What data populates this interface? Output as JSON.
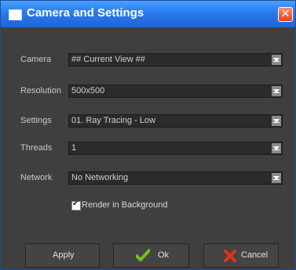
{
  "window": {
    "title": "Camera and Settings",
    "close_symbol": "✕"
  },
  "fields": {
    "camera": {
      "label": "Camera",
      "value": "## Current View ##"
    },
    "resolution": {
      "label": "Resolution",
      "value": "500x500"
    },
    "settings": {
      "label": "Settings",
      "value": "01. Ray Tracing - Low"
    },
    "threads": {
      "label": "Threads",
      "value": "1"
    },
    "network": {
      "label": "Network",
      "value": "No Networking"
    }
  },
  "options": {
    "render_background_label": "Render in Background",
    "render_background_checked": true
  },
  "buttons": {
    "apply": "Apply",
    "ok": "Ok",
    "cancel": "Cancel"
  },
  "icons": {
    "ok": "checkmark-icon",
    "cancel": "x-icon",
    "title": "window-icon",
    "dropdown": "chevron-down-icon"
  },
  "colors": {
    "titlebar": "#2b7df0",
    "panel": "#3f3f3f",
    "ok_icon": "#6cc21c",
    "cancel_icon": "#e0321d"
  }
}
